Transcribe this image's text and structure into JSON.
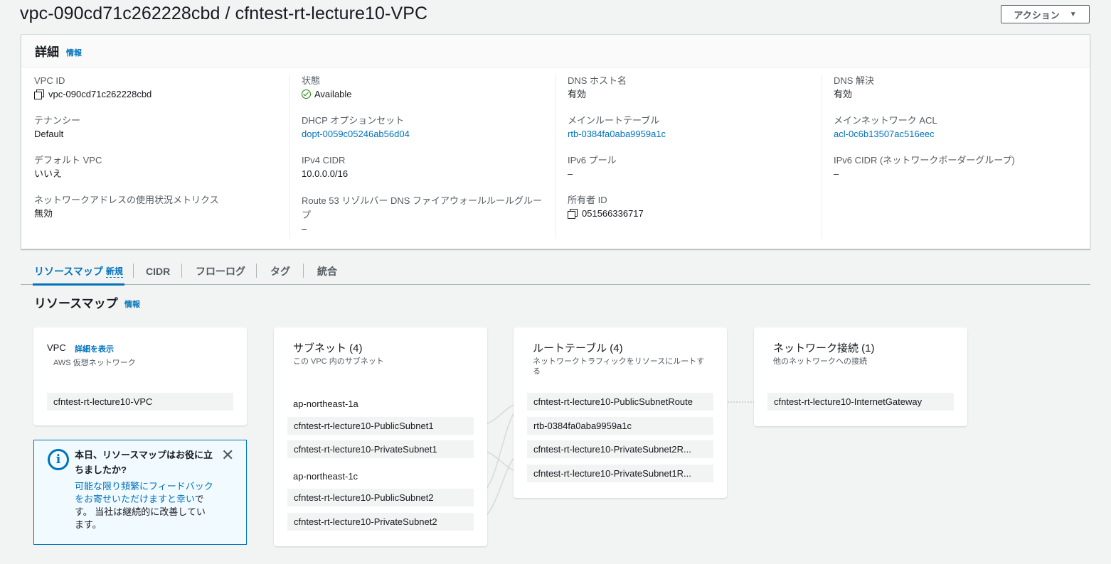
{
  "page": {
    "title": "vpc-090cd71c262228cbd / cfntest-rt-lecture10-VPC",
    "actions_label": "アクション"
  },
  "details": {
    "title": "詳細",
    "info": "情報",
    "col1": [
      {
        "label": "VPC ID",
        "value": "vpc-090cd71c262228cbd"
      },
      {
        "label": "テナンシー",
        "value": "Default"
      },
      {
        "label": "デフォルト VPC",
        "value": "いいえ"
      },
      {
        "label": "ネットワークアドレスの使用状況メトリクス",
        "value": "無効"
      }
    ],
    "col2": [
      {
        "label": "状態",
        "value": "Available"
      },
      {
        "label": "DHCP オプションセット",
        "value": "dopt-0059c05246ab56d04"
      },
      {
        "label": "IPv4 CIDR",
        "value": "10.0.0.0/16"
      },
      {
        "label": "Route 53 リゾルバー DNS ファイアウォールルールグループ",
        "value": "–"
      }
    ],
    "col3": [
      {
        "label": "DNS ホスト名",
        "value": "有効"
      },
      {
        "label": "メインルートテーブル",
        "value": "rtb-0384fa0aba9959a1c"
      },
      {
        "label": "IPv6 プール",
        "value": "–"
      },
      {
        "label": "所有者 ID",
        "value": "051566336717"
      }
    ],
    "col4": [
      {
        "label": "DNS 解決",
        "value": "有効"
      },
      {
        "label": "メインネットワーク ACL",
        "value": "acl-0c6b13507ac516eec"
      },
      {
        "label": "IPv6 CIDR (ネットワークボーダーグループ)",
        "value": "–"
      }
    ]
  },
  "tabs": [
    {
      "label": "リソースマップ",
      "badge": "新規"
    },
    {
      "label": "CIDR"
    },
    {
      "label": "フローログ"
    },
    {
      "label": "タグ"
    },
    {
      "label": "統合"
    }
  ],
  "resource_map": {
    "title": "リソースマップ",
    "info": "情報",
    "vpc_card": {
      "title": "VPC",
      "link": "詳細を表示",
      "subtitle": "AWS 仮想ネットワーク",
      "item": "cfntest-rt-lecture10-VPC"
    },
    "subnet_card": {
      "title": "サブネット (4)",
      "subtitle": "この VPC 内のサブネット",
      "az1": "ap-northeast-1a",
      "az1_items": [
        "cfntest-rt-lecture10-PublicSubnet1",
        "cfntest-rt-lecture10-PrivateSubnet1"
      ],
      "az2": "ap-northeast-1c",
      "az2_items": [
        "cfntest-rt-lecture10-PublicSubnet2",
        "cfntest-rt-lecture10-PrivateSubnet2"
      ]
    },
    "route_card": {
      "title": "ルートテーブル (4)",
      "subtitle": "ネットワークトラフィックをリソースにルートする",
      "items": [
        "cfntest-rt-lecture10-PublicSubnetRoute",
        "rtb-0384fa0aba9959a1c",
        "cfntest-rt-lecture10-PrivateSubnet2R...",
        "cfntest-rt-lecture10-PrivateSubnet1R..."
      ]
    },
    "network_card": {
      "title": "ネットワーク接続 (1)",
      "subtitle": "他のネットワークへの接続",
      "item": "cfntest-rt-lecture10-InternetGateway"
    },
    "feedback": {
      "title": "本日、リソースマップはお役に立ちましたか?",
      "body_link": "可能な限り頻繁にフィードバックをお寄せいただけますと幸い",
      "body_text": "です。 当社は継続的に改善しています。"
    }
  },
  "colors": {
    "link": "#0073bb",
    "success": "#1d8102",
    "background": "#f2f3f3"
  }
}
